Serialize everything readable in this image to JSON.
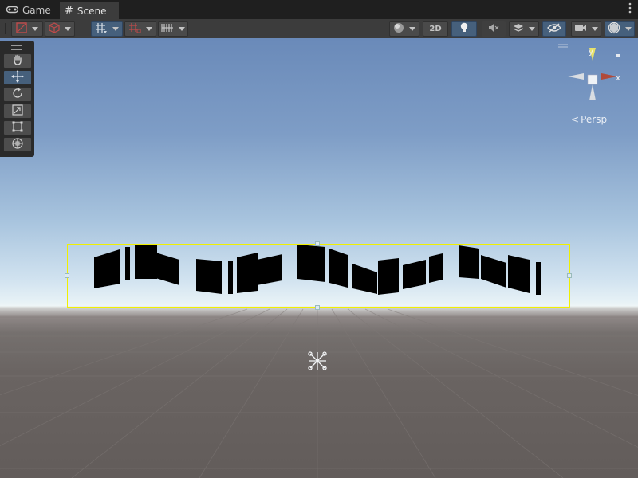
{
  "tabs": [
    {
      "label": "Game",
      "icon": "gamepad-icon"
    },
    {
      "label": "Scene",
      "icon": "hash-icon"
    }
  ],
  "toolbar": {
    "mode_2d_label": "2D"
  },
  "gizmo": {
    "y_label": "y",
    "x_label": "x",
    "projection_label": "Persp"
  },
  "colors": {
    "selection": "#f0f000",
    "active_tool": "#46607c",
    "toolbar_bg": "#3c3c3c"
  }
}
